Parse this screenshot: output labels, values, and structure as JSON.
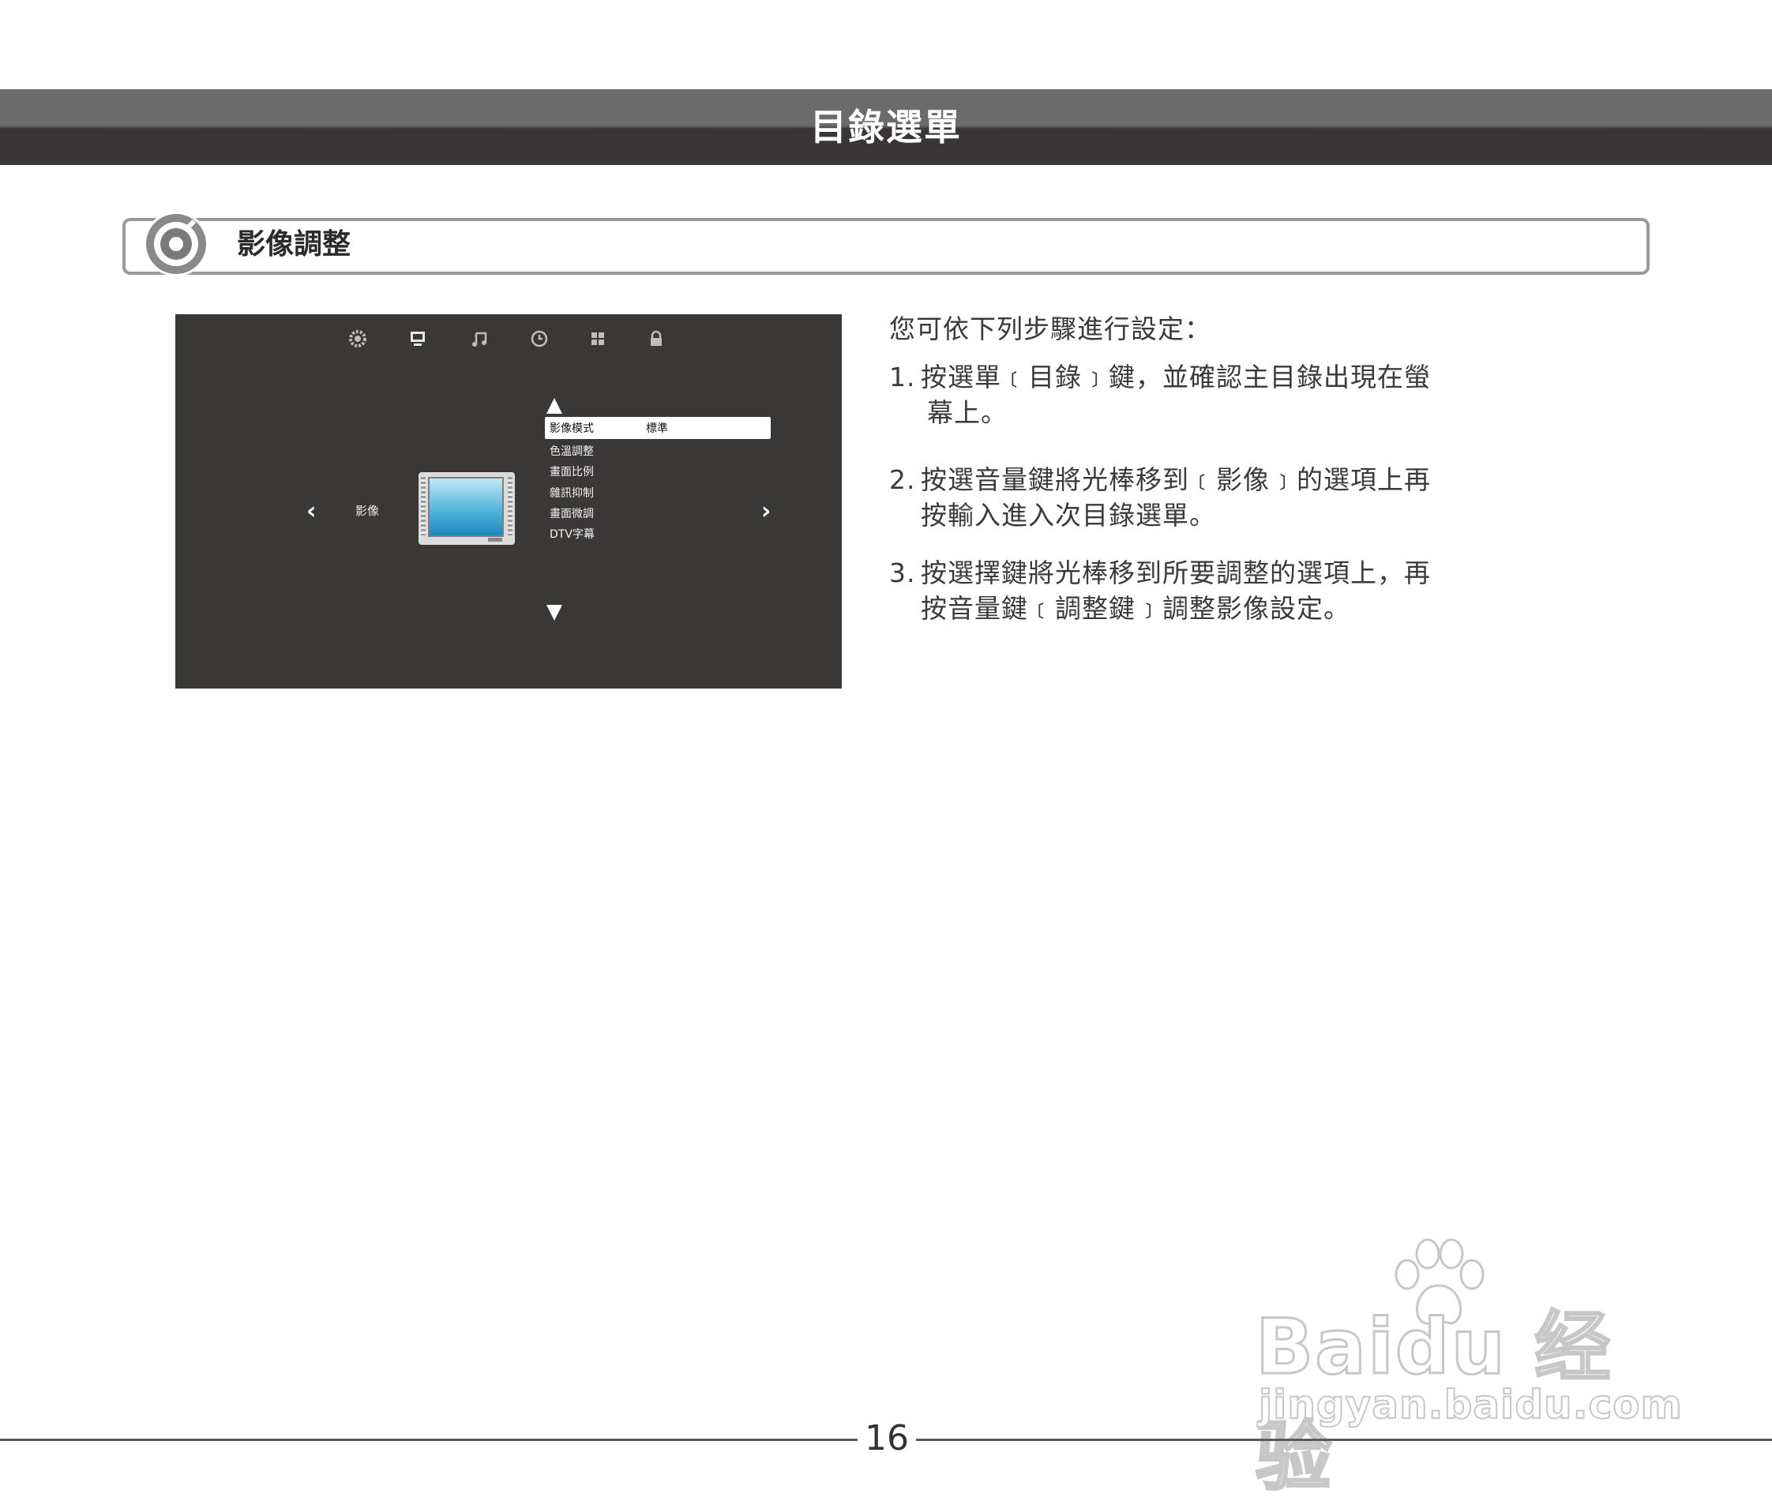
{
  "header": {
    "title": "目錄選單"
  },
  "section": {
    "title": "影像調整",
    "icon": "target-circle-icon"
  },
  "tv_screen": {
    "top_icons": [
      "settings-gear-icon",
      "picture-monitor-icon",
      "music-note-icon",
      "clock-icon",
      "grid-icon",
      "lock-icon"
    ],
    "side_label": "影像",
    "left_arrow": "‹",
    "right_arrow": "›",
    "selected_item": {
      "label": "影像模式",
      "value": "標準"
    },
    "menu_items": [
      "色溫調整",
      "畫面比例",
      "雜訊抑制",
      "畫面微調",
      "DTV字幕"
    ]
  },
  "instructions": {
    "intro": "您可依下列步驟進行設定：",
    "steps": [
      {
        "num": "1.",
        "line1": "按選單﹝目錄﹞鍵，並確認主目錄出現在螢",
        "line2": "幕上。"
      },
      {
        "num": "2.",
        "line1": "按選音量鍵將光棒移到﹝影像﹞的選項上再",
        "line2": "按輸入進入次目錄選單。"
      },
      {
        "num": "3.",
        "line1": "按選擇鍵將光棒移到所要調整的選項上，再",
        "line2": "按音量鍵﹝調整鍵﹞調整影像設定。"
      }
    ]
  },
  "footer": {
    "page_number": "16"
  },
  "watermark": {
    "main": "Baidu 经验",
    "sub": "jingyan.baidu.com"
  },
  "colors": {
    "header_dark": "#3a3637",
    "header_light": "#6b6b6b",
    "screen_bg": "#3a3737",
    "section_border": "#9a9a9a"
  }
}
